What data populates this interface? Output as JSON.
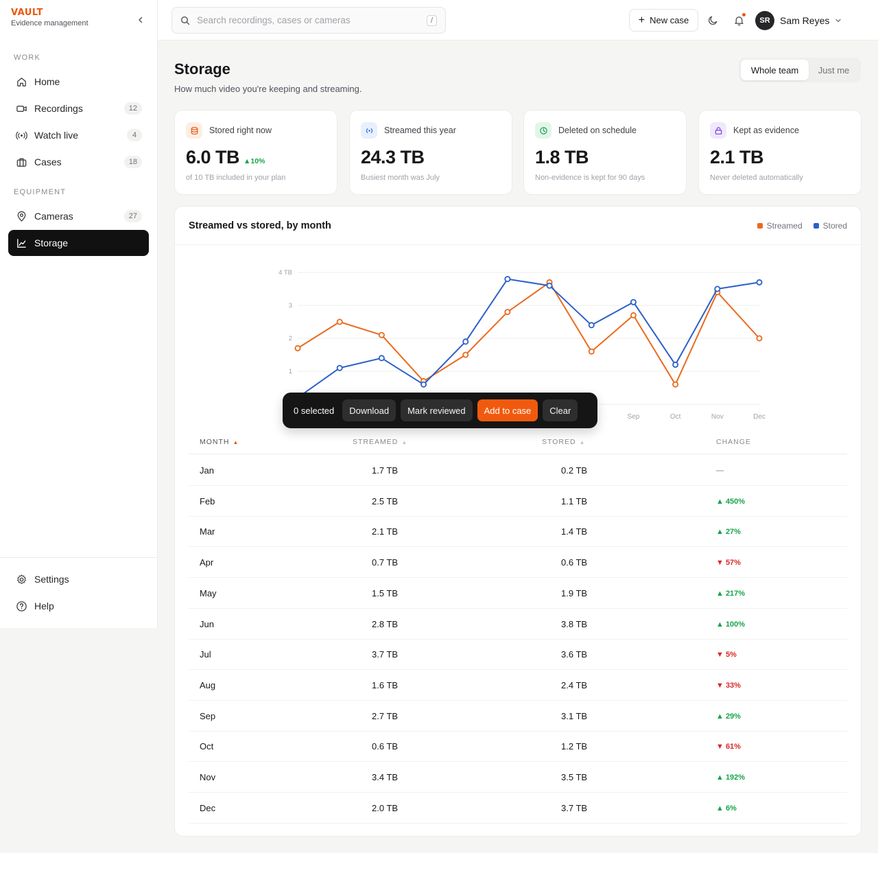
{
  "brand": {
    "logo": "VAULT",
    "subtitle": "Evidence management"
  },
  "sidebar": {
    "sections": [
      {
        "label": "WORK"
      },
      {
        "label": "EQUIPMENT"
      }
    ],
    "items": [
      {
        "label": "Home",
        "count": ""
      },
      {
        "label": "Recordings",
        "count": "12"
      },
      {
        "label": "Watch live",
        "count": "4"
      },
      {
        "label": "Cases",
        "count": "18"
      },
      {
        "label": "Cameras",
        "count": "27"
      },
      {
        "label": "Storage",
        "count": ""
      }
    ],
    "footer": [
      {
        "label": "Settings"
      },
      {
        "label": "Help"
      }
    ]
  },
  "topbar": {
    "search_placeholder": "Search recordings, cases or cameras",
    "search_shortcut": "/",
    "new_case_label": "New case",
    "user_initials": "SR",
    "user_name": "Sam Reyes"
  },
  "page": {
    "title": "Storage",
    "subtitle": "How much video you're keeping and streaming.",
    "scope_options": [
      "Whole team",
      "Just me"
    ],
    "scope_selected": "Whole team"
  },
  "stats": [
    {
      "label": "Stored right now",
      "value": "6.0 TB",
      "delta": "▲10%",
      "note": "of 10 TB included in your plan",
      "icon": "database-icon",
      "tint": "#fdeee4",
      "color": "#ea580c"
    },
    {
      "label": "Streamed this year",
      "value": "24.3 TB",
      "delta": "",
      "note": "Busiest month was July",
      "icon": "broadcast-icon",
      "tint": "#e8effd",
      "color": "#2563eb"
    },
    {
      "label": "Deleted on schedule",
      "value": "1.8 TB",
      "delta": "",
      "note": "Non-evidence is kept for 90 days",
      "icon": "clock-icon",
      "tint": "#e3f5ea",
      "color": "#16a34a"
    },
    {
      "label": "Kept as evidence",
      "value": "2.1 TB",
      "delta": "",
      "note": "Never deleted automatically",
      "icon": "lock-icon",
      "tint": "#efe9fb",
      "color": "#7c3aed"
    }
  ],
  "chart_card": {
    "title": "Streamed vs stored, by month",
    "legend": [
      {
        "name": "Streamed",
        "color": "#ea6a1e"
      },
      {
        "name": "Stored",
        "color": "#2c5fca"
      }
    ]
  },
  "chart_data": {
    "type": "line",
    "categories": [
      "Jan",
      "Feb",
      "Mar",
      "Apr",
      "May",
      "Jun",
      "Jul",
      "Aug",
      "Sep",
      "Oct",
      "Nov",
      "Dec"
    ],
    "visible_x_tick_labels": [
      "Sep",
      "Oct",
      "Nov",
      "Dec"
    ],
    "y_tick_labels": [
      "4 TB",
      "3",
      "2",
      "1"
    ],
    "y_ticks": [
      4,
      3,
      2,
      1
    ],
    "ylim": [
      0,
      4
    ],
    "grid": true,
    "legend_position": "top-right",
    "series": [
      {
        "name": "Streamed",
        "color": "#ea6a1e",
        "values": [
          1.7,
          2.5,
          2.1,
          0.7,
          1.5,
          2.8,
          3.7,
          1.6,
          2.7,
          0.6,
          3.4,
          2.0
        ]
      },
      {
        "name": "Stored",
        "color": "#2c5fca",
        "values": [
          0.2,
          1.1,
          1.4,
          0.6,
          1.9,
          3.8,
          3.6,
          2.4,
          3.1,
          1.2,
          3.5,
          3.7
        ]
      }
    ]
  },
  "actionbar": {
    "selected_text": "0 selected",
    "buttons": [
      "Download",
      "Mark reviewed",
      "Add to case",
      "Clear"
    ]
  },
  "table": {
    "headers": [
      "MONTH",
      "STREAMED",
      "STORED",
      "CHANGE"
    ],
    "sorted_by": "MONTH",
    "rows": [
      {
        "month": "Jan",
        "streamed": "1.7 TB",
        "stored": "0.2 TB",
        "change": "—",
        "dir": "neutral"
      },
      {
        "month": "Feb",
        "streamed": "2.5 TB",
        "stored": "1.1 TB",
        "change": "▲ 450%",
        "dir": "up"
      },
      {
        "month": "Mar",
        "streamed": "2.1 TB",
        "stored": "1.4 TB",
        "change": "▲ 27%",
        "dir": "up"
      },
      {
        "month": "Apr",
        "streamed": "0.7 TB",
        "stored": "0.6 TB",
        "change": "▼ 57%",
        "dir": "down"
      },
      {
        "month": "May",
        "streamed": "1.5 TB",
        "stored": "1.9 TB",
        "change": "▲ 217%",
        "dir": "up"
      },
      {
        "month": "Jun",
        "streamed": "2.8 TB",
        "stored": "3.8 TB",
        "change": "▲ 100%",
        "dir": "up"
      },
      {
        "month": "Jul",
        "streamed": "3.7 TB",
        "stored": "3.6 TB",
        "change": "▼ 5%",
        "dir": "down"
      },
      {
        "month": "Aug",
        "streamed": "1.6 TB",
        "stored": "2.4 TB",
        "change": "▼ 33%",
        "dir": "down"
      },
      {
        "month": "Sep",
        "streamed": "2.7 TB",
        "stored": "3.1 TB",
        "change": "▲ 29%",
        "dir": "up"
      },
      {
        "month": "Oct",
        "streamed": "0.6 TB",
        "stored": "1.2 TB",
        "change": "▼ 61%",
        "dir": "down"
      },
      {
        "month": "Nov",
        "streamed": "3.4 TB",
        "stored": "3.5 TB",
        "change": "▲ 192%",
        "dir": "up"
      },
      {
        "month": "Dec",
        "streamed": "2.0 TB",
        "stored": "3.7 TB",
        "change": "▲ 6%",
        "dir": "up"
      }
    ]
  }
}
